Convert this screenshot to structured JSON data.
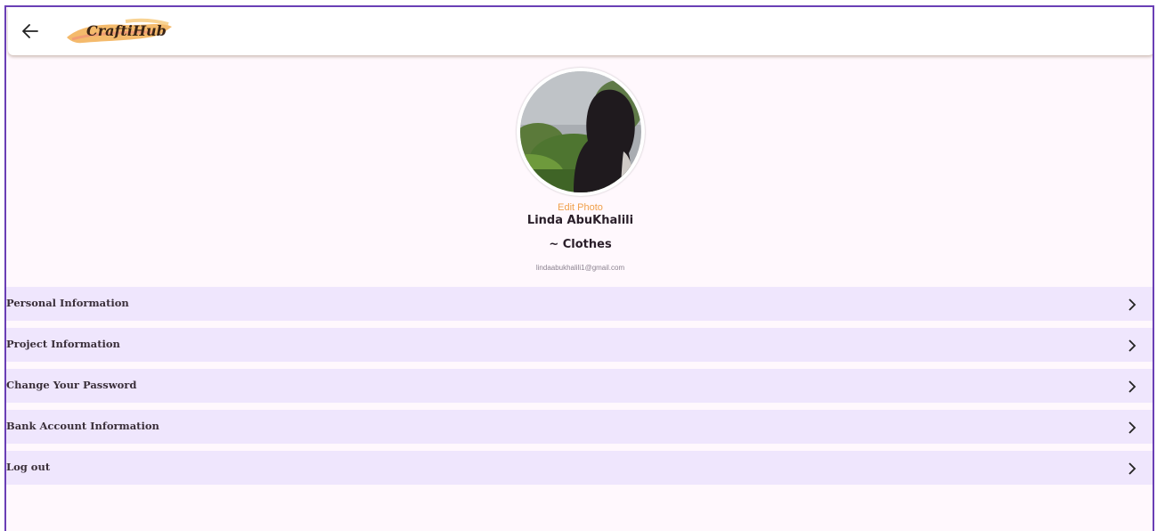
{
  "header": {
    "back_icon": "arrow-left-icon",
    "logo_text": "CraftiHub"
  },
  "profile": {
    "edit_photo_label": "Edit Photo",
    "name": "Linda AbuKhalili",
    "category": "~ Clothes",
    "email": "lindaabukhalili1@gmail.com"
  },
  "menu": {
    "items": [
      {
        "label": "Personal Information",
        "icon": "chevron-right-icon"
      },
      {
        "label": "Project Information",
        "icon": "chevron-right-icon"
      },
      {
        "label": "Change Your Password",
        "icon": "chevron-right-icon"
      },
      {
        "label": "Bank Account Information",
        "icon": "chevron-right-icon"
      },
      {
        "label": "Log out",
        "icon": "chevron-right-icon"
      }
    ]
  },
  "colors": {
    "frame_border": "#6a3fb5",
    "accent": "#f0a04b",
    "menu_bg": "#efe6fd",
    "page_bg": "#fff8fd"
  }
}
